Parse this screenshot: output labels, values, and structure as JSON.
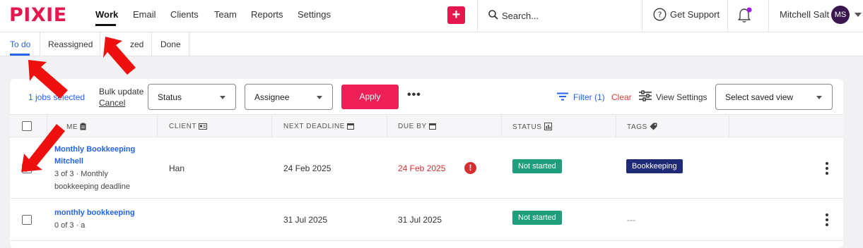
{
  "header": {
    "logo": "PIXIE",
    "nav": [
      "Work",
      "Email",
      "Clients",
      "Team",
      "Reports",
      "Settings"
    ],
    "active_nav": "Work",
    "search_placeholder": "Search...",
    "support_label": "Get Support",
    "user_name": "Mitchell Salt",
    "user_initials": "MS",
    "brand_color": "#e5174f"
  },
  "subtabs": {
    "items": [
      "To do",
      "Reassigned",
      "Snoozed",
      "Done"
    ],
    "active": "To do",
    "snoozed_visible_text": "zed"
  },
  "toolbar": {
    "selected_count": "1 jobs selected",
    "bulk_update": "Bulk update",
    "cancel": "Cancel",
    "status_select": "Status",
    "assignee_select": "Assignee",
    "apply": "Apply",
    "more": "•••",
    "filter": "Filter (1)",
    "clear": "Clear",
    "view_settings": "View Settings",
    "saved_view_placeholder": "Select saved view"
  },
  "table": {
    "columns": [
      "ME",
      "CLIENT",
      "NEXT DEADLINE",
      "DUE BY",
      "STATUS",
      "TAGS"
    ],
    "rows": [
      {
        "checked": true,
        "title_line1": "Monthly Bookkeeping",
        "title_line2": "Mitchell",
        "sub_line1": "3 of 3 · Monthly",
        "sub_line2": "bookkeeping deadline",
        "client": "Han",
        "next_deadline": "24 Feb 2025",
        "due_by": "24 Feb 2025",
        "overdue": true,
        "status": "Not started",
        "tag": "Bookkeeping"
      },
      {
        "checked": false,
        "title_line1": "monthly bookkeeping",
        "sub_line1": "0 of 3 · a",
        "client": "",
        "next_deadline": "31 Jul 2025",
        "due_by": "31 Jul 2025",
        "overdue": false,
        "status": "Not started",
        "tag": "---"
      }
    ]
  },
  "annotations": {
    "arrow_color": "#ee0f0f",
    "arrow_count": 3
  }
}
